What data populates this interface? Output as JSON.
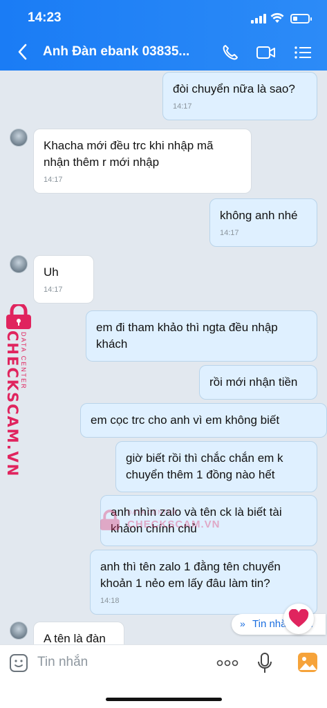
{
  "status": {
    "time": "14:23"
  },
  "header": {
    "title": "Anh Đàn ebank 03835..."
  },
  "messages": [
    {
      "dir": "out",
      "text": "đòi chuyển nữa là sao?",
      "time": "14:17"
    },
    {
      "dir": "in",
      "text": " Khacha mới đều trc khi nhập mã nhận thêm r mới nhập",
      "time": "14:17"
    },
    {
      "dir": "out",
      "text": "không anh nhé",
      "time": "14:17"
    },
    {
      "dir": "in",
      "text": "Uh",
      "time": "14:17"
    },
    {
      "dir": "out",
      "text": "em đi tham khảo thì ngta đều nhập khách",
      "time": ""
    },
    {
      "dir": "out",
      "text": "rồi mới nhận tiền",
      "time": ""
    },
    {
      "dir": "out",
      "text": "em cọc trc cho anh vì em không biết",
      "time": ""
    },
    {
      "dir": "out",
      "text": "giờ biết rồi thì chắc chắn em k chuyển thêm 1 đồng nào hết",
      "time": ""
    },
    {
      "dir": "out",
      "text": "anh nhìn zalo và tên ck là biết tài khảon chính chủ",
      "time": ""
    },
    {
      "dir": "out",
      "text": "anh thì tên zalo 1 đằng tên chuyển khoản 1 nẻo em lấy đâu làm tin?",
      "time": "14:18"
    },
    {
      "dir": "in",
      "text": "A tên là đàn",
      "time": ""
    }
  ],
  "new_messages": {
    "label": "Tin nhắn mới"
  },
  "input": {
    "placeholder": "Tin nhắn"
  },
  "watermark": {
    "brand": "CHECKSCAM.VN",
    "sub": "DATA CENTER"
  },
  "colors": {
    "header": "#1a7cf5",
    "outgoing_bubble": "#dff0ff",
    "incoming_bubble": "#ffffff",
    "watermark": "#e0245e",
    "heart": "#e0245e"
  },
  "icons": {
    "back": "chevron-left-icon",
    "call": "phone-icon",
    "video": "video-icon",
    "menu": "list-icon",
    "sticker": "sticker-icon",
    "more": "more-dots-icon",
    "mic": "microphone-icon",
    "gallery": "image-icon",
    "reaction": "heart-icon",
    "scroll": "double-chevron-down-icon"
  }
}
